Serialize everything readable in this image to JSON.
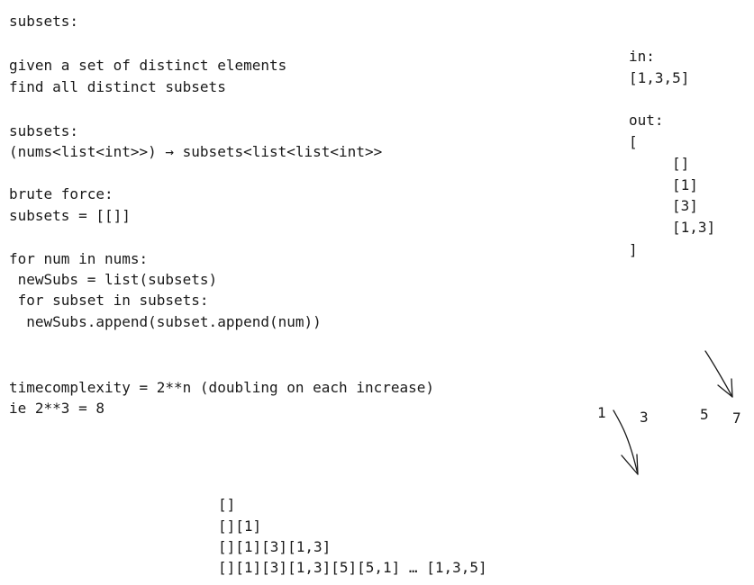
{
  "notes": {
    "title": "subsets:",
    "problem": [
      "given a set of distinct elements",
      "find all distinct subsets"
    ],
    "signature_label": "subsets:",
    "signature": "(nums<list<int>>) → subsets<list<list<int>>",
    "brute_force_label": "brute force:",
    "init": "subsets = [[]]",
    "code": [
      "for num in nums:",
      " newSubs = list(subsets)",
      " for subset in subsets:",
      "  newSubs.append(subset.append(num))"
    ],
    "complexity": "timecomplexity = 2**n (doubling on each increase)",
    "example": "ie 2**3 = 8"
  },
  "example_io": {
    "in_label": "in:",
    "in_value": "[1,3,5]",
    "out_label": "out:",
    "open_bracket": "[",
    "out_items": [
      "[]",
      "[1]",
      "[3]",
      "[1,3]"
    ],
    "close_bracket": "]"
  },
  "number_row": [
    "1",
    "3",
    "5",
    "7"
  ],
  "growth": [
    "[]",
    "[][1]",
    "[][1][3][1,3]",
    "[][1][3][1,3][5][5,1] … [1,3,5]"
  ]
}
